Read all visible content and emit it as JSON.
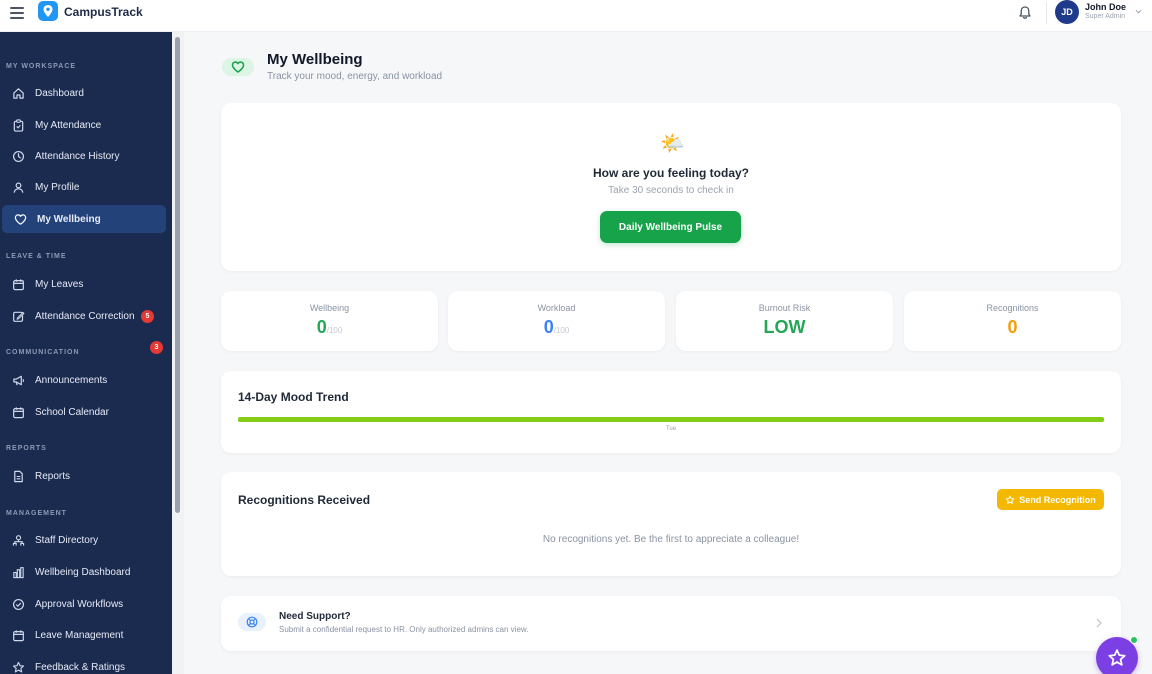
{
  "app": {
    "name": "CampusTrack"
  },
  "user": {
    "initials": "JD",
    "name": "John Doe",
    "role": "Super Admin"
  },
  "sidebar": {
    "sections": [
      {
        "title": "MY WORKSPACE",
        "items": [
          {
            "label": "Dashboard",
            "icon": "home-icon"
          },
          {
            "label": "My Attendance",
            "icon": "clipboard-icon"
          },
          {
            "label": "Attendance History",
            "icon": "clock-icon"
          },
          {
            "label": "My Profile",
            "icon": "user-icon"
          },
          {
            "label": "My Wellbeing",
            "icon": "heart-icon",
            "active": true
          }
        ]
      },
      {
        "title": "LEAVE & TIME",
        "items": [
          {
            "label": "My Leaves",
            "icon": "calendar-icon",
            "badge": "5"
          },
          {
            "label": "Attendance Correction",
            "icon": "edit-icon",
            "badge": "3"
          }
        ]
      },
      {
        "title": "COMMUNICATION",
        "items": [
          {
            "label": "Announcements",
            "icon": "megaphone-icon"
          },
          {
            "label": "School Calendar",
            "icon": "calendar-icon"
          }
        ]
      },
      {
        "title": "REPORTS",
        "items": [
          {
            "label": "Reports",
            "icon": "document-icon"
          }
        ]
      },
      {
        "title": "MANAGEMENT",
        "items": [
          {
            "label": "Staff Directory",
            "icon": "users-icon"
          },
          {
            "label": "Wellbeing Dashboard",
            "icon": "bar-chart-icon"
          },
          {
            "label": "Approval Workflows",
            "icon": "check-circle-icon"
          },
          {
            "label": "Leave Management",
            "icon": "calendar-icon"
          },
          {
            "label": "Feedback & Ratings",
            "icon": "star-icon"
          }
        ]
      }
    ]
  },
  "page": {
    "title": "My Wellbeing",
    "subtitle": "Track your mood, energy, and workload"
  },
  "pulse": {
    "emoji": "🌤️",
    "question": "How are you feeling today?",
    "subtitle": "Take 30 seconds to check in",
    "button_label": "Daily Wellbeing Pulse"
  },
  "stats": {
    "wellbeing": {
      "label": "Wellbeing",
      "value": "0",
      "suffix": "/100",
      "color": "#22a855"
    },
    "workload": {
      "label": "Workload",
      "value": "0",
      "suffix": "/100",
      "color": "#3b82f6"
    },
    "burnout": {
      "label": "Burnout Risk",
      "value": "LOW",
      "color": "#22a855"
    },
    "recognitions": {
      "label": "Recognitions",
      "value": "0",
      "color": "#f59e0b"
    }
  },
  "mood_trend": {
    "title": "14-Day Mood Trend",
    "tick_label": "Tue"
  },
  "recognitions": {
    "title": "Recognitions Received",
    "button_label": "Send Recognition",
    "empty_text": "No recognitions yet. Be the first to appreciate a colleague!"
  },
  "support": {
    "title": "Need Support?",
    "subtitle": "Submit a confidential request to HR. Only authorized admins can view."
  },
  "colors": {
    "sidebar_bg": "#1b2a4f",
    "active_item": "#24427a",
    "primary_green": "#16a34a",
    "accent_yellow": "#f5b800",
    "fab_purple": "#7b3fe4"
  }
}
